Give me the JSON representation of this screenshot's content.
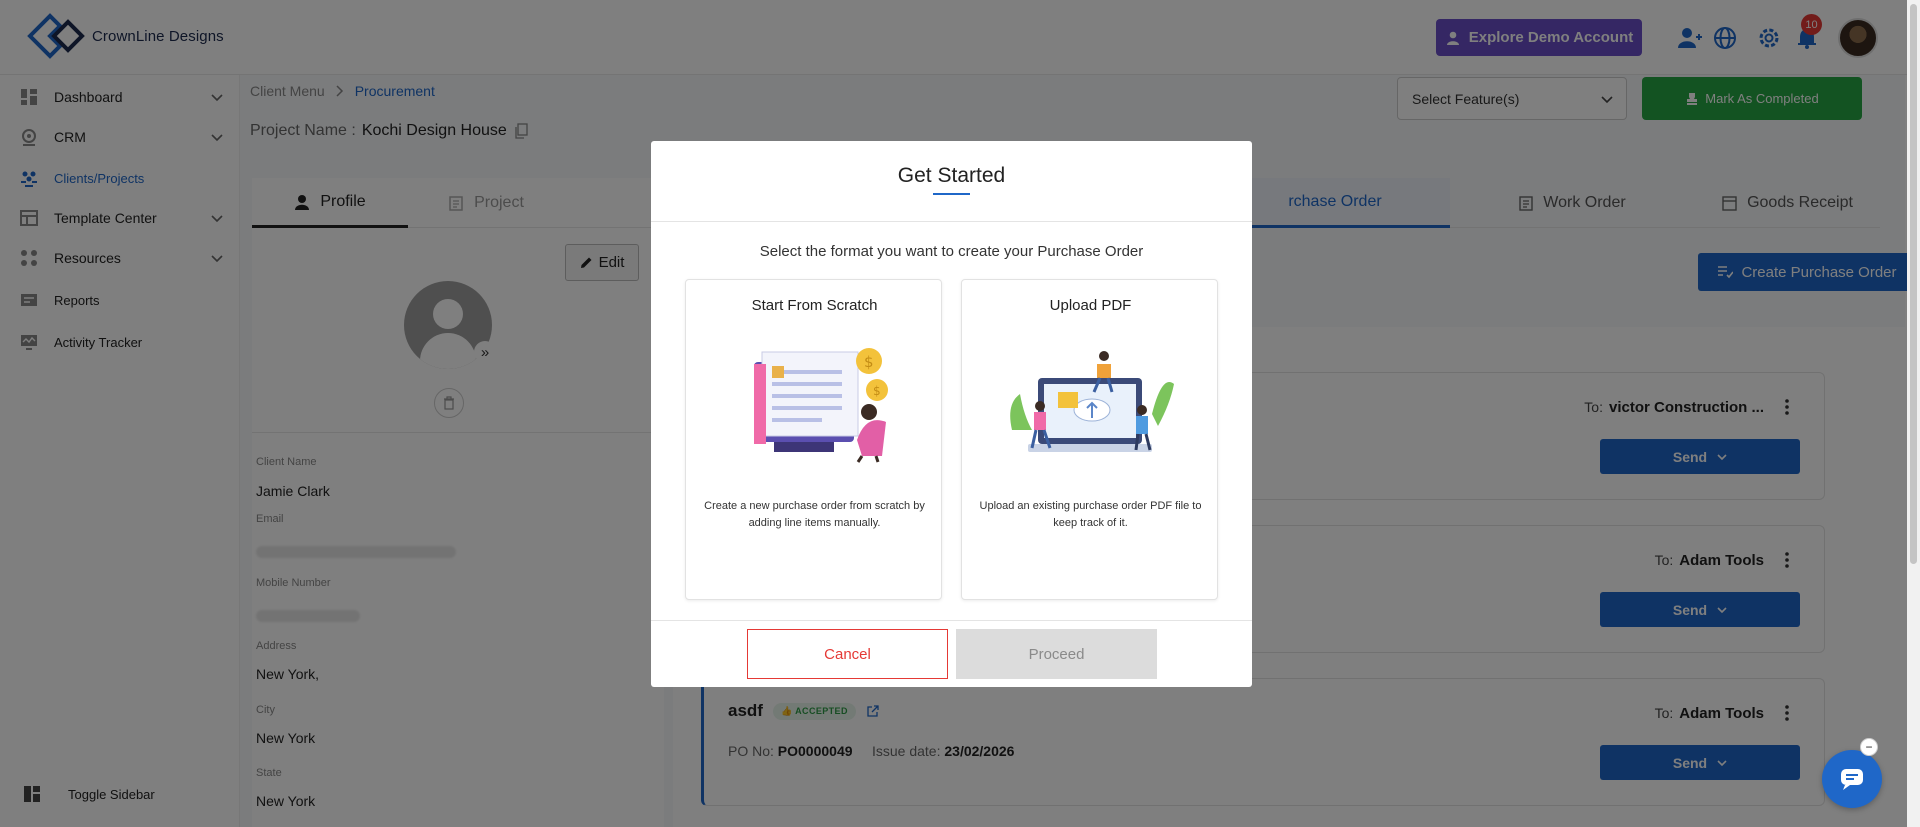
{
  "header": {
    "brand": "CrownLine Designs",
    "demo_button": "Explore Demo Account",
    "notifications_count": "10",
    "icons": [
      "user-add-icon",
      "globe-icon",
      "gear-icon",
      "bell-icon"
    ]
  },
  "sidebar": {
    "items": [
      {
        "label": "Dashboard",
        "icon": "dashboard-icon",
        "expandable": true
      },
      {
        "label": "CRM",
        "icon": "crm-icon",
        "expandable": true
      },
      {
        "label": "Clients/Projects",
        "icon": "clients-icon",
        "expandable": false,
        "active": true
      },
      {
        "label": "Template Center",
        "icon": "template-icon",
        "expandable": true
      },
      {
        "label": "Resources",
        "icon": "resources-icon",
        "expandable": true
      },
      {
        "label": "Reports",
        "icon": "reports-icon",
        "expandable": false
      },
      {
        "label": "Activity Tracker",
        "icon": "activity-icon",
        "expandable": false
      }
    ],
    "toggle_label": "Toggle Sidebar"
  },
  "breadcrumb": {
    "parent": "Client Menu",
    "current": "Procurement"
  },
  "project": {
    "label": "Project Name :",
    "name": "Kochi Design House"
  },
  "toolbar": {
    "select_feature": "Select Feature(s)",
    "mark_completed": "Mark As Completed"
  },
  "left_panel": {
    "tabs": [
      "Profile",
      "Project"
    ],
    "edit_label": "Edit",
    "fields": [
      {
        "label": "Client Name",
        "value": "Jamie Clark"
      },
      {
        "label": "Email",
        "value": ""
      },
      {
        "label": "Mobile Number",
        "value": ""
      },
      {
        "label": "Address",
        "value": "New York,"
      },
      {
        "label": "City",
        "value": "New York"
      },
      {
        "label": "State",
        "value": "New York"
      }
    ]
  },
  "right_panel": {
    "tabs": [
      "Purchase Order",
      "Work Order",
      "Goods Receipt"
    ],
    "tab_partial_purchase": "rchase Order",
    "create_button": "Create Purchase Order",
    "orders": [
      {
        "to_label": "To:",
        "to": "victor Construction ...",
        "send": "Send"
      },
      {
        "to_label": "To:",
        "to": "Adam Tools",
        "send": "Send"
      },
      {
        "title": "asdf",
        "status": "ACCEPTED",
        "po_label": "PO No:",
        "po_no": "PO0000049",
        "date_label": "Issue date:",
        "date": "23/02/2026",
        "to_label": "To:",
        "to": "Adam Tools",
        "send": "Send"
      }
    ]
  },
  "modal": {
    "title": "Get Started",
    "subtitle": "Select the format you want to create your Purchase Order",
    "options": [
      {
        "title": "Start From Scratch",
        "description": "Create a new purchase order from scratch by adding line items manually."
      },
      {
        "title": "Upload PDF",
        "description": "Upload an existing purchase order PDF file to keep track of it."
      }
    ],
    "cancel": "Cancel",
    "proceed": "Proceed"
  },
  "colors": {
    "accent": "#1f67c8",
    "demo": "#6a4fc8",
    "success": "#27a744",
    "danger": "#e53935"
  }
}
